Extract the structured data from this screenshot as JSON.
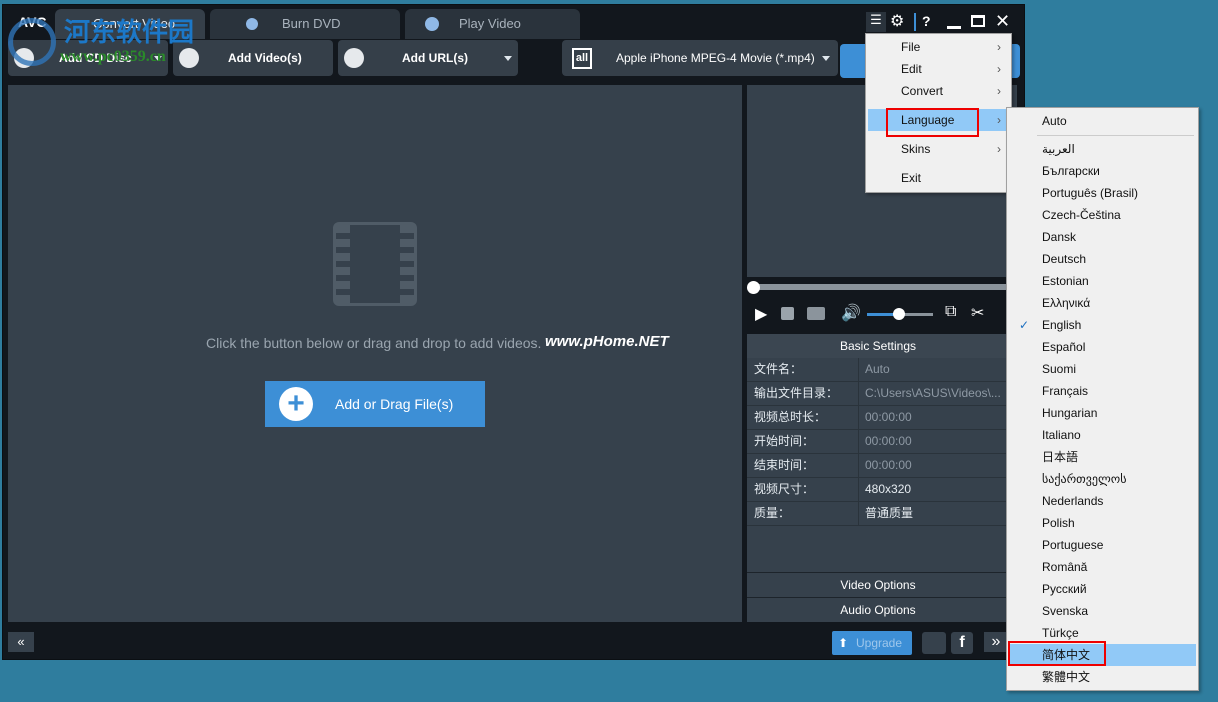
{
  "window": {
    "logo": "AVC",
    "tabs": [
      {
        "label": "Convert Video",
        "active": true
      },
      {
        "label": "Burn DVD"
      },
      {
        "label": "Play Video"
      }
    ],
    "title_icons": [
      "menu-icon",
      "gear-icon",
      "help-icon",
      "minimize-icon",
      "maximize-icon",
      "close-icon"
    ],
    "help_label": "?"
  },
  "toolbar": {
    "add_cd": "Add CD Disc",
    "add_video": "Add Video(s)",
    "add_url": "Add URL(s)",
    "format_icon_label": "all",
    "format": "Apple iPhone MPEG-4 Movie (*.mp4)"
  },
  "main": {
    "hint": "Click the button below or drag and drop to add videos.",
    "add_button": "Add or Drag File(s)"
  },
  "player": {
    "progress": 0,
    "volume": 0.6
  },
  "settings": {
    "header": "Basic Settings",
    "rows": [
      {
        "label": "文件名：",
        "value": "Auto"
      },
      {
        "label": "输出文件目录：",
        "value": "C:\\Users\\ASUS\\Videos\\..."
      },
      {
        "label": "视频总时长：",
        "value": "00:00:00"
      },
      {
        "label": "开始时间：",
        "value": "00:00:00"
      },
      {
        "label": "结束时间：",
        "value": "00:00:00"
      },
      {
        "label": "视频尺寸：",
        "value": "480x320"
      },
      {
        "label": "质量：",
        "value": "普通质量"
      }
    ],
    "video_options": "Video Options",
    "audio_options": "Audio Options"
  },
  "bottom": {
    "upgrade": "Upgrade",
    "twitter": "twitter-icon",
    "facebook": "f"
  },
  "menu": {
    "items": [
      "File",
      "Edit",
      "Convert",
      "Language",
      "Skins",
      "Exit"
    ],
    "highlighted": "Language"
  },
  "language_menu": {
    "items": [
      "Auto",
      "العربية",
      "Български",
      "Português (Brasil)",
      "Czech-Čeština",
      "Dansk",
      "Deutsch",
      "Estonian",
      "Ελληνικά",
      "English",
      "Español",
      "Suomi",
      "Français",
      "Hungarian",
      "Italiano",
      "日本語",
      "საქართველოს",
      "Nederlands",
      "Polish",
      "Portuguese",
      "Română",
      "Русский",
      "Svenska",
      "Türkçe",
      "简体中文",
      "繁體中文"
    ],
    "checked": "English",
    "highlighted": "简体中文"
  },
  "watermarks": {
    "site_cn": "河东软件园",
    "site_url": "www.pc0359.cn",
    "phome": "www.pHome.NET"
  },
  "colors": {
    "accent": "#3d8fd6",
    "highlight": "#91c9f7",
    "annotation": "#e00000"
  }
}
